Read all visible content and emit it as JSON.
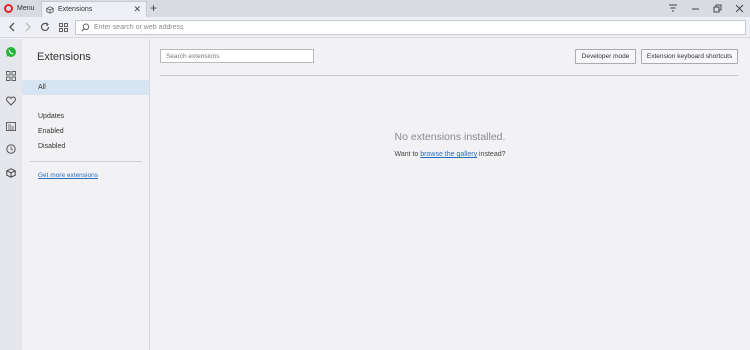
{
  "tabbar": {
    "menu_label": "Menu",
    "tab_title": "Extensions",
    "tab_icon": "cube-icon",
    "close_glyph": "✕",
    "new_tab_glyph": "+"
  },
  "addressbar": {
    "placeholder": "Enter search or web address"
  },
  "sidebar_icons": [
    "whatsapp-icon",
    "speed-dial-icon",
    "heart-icon",
    "news-icon",
    "history-icon",
    "extensions-icon"
  ],
  "extnav": {
    "title": "Extensions",
    "items": [
      {
        "label": "All",
        "active": true
      },
      {
        "label": "Updates"
      },
      {
        "label": "Enabled"
      },
      {
        "label": "Disabled"
      }
    ],
    "more_link": "Get more extensions"
  },
  "main": {
    "search_placeholder": "Search extensions",
    "developer_mode": "Developer mode",
    "keyboard_shortcuts": "Extension keyboard shortcuts",
    "empty_title": "No extensions installed.",
    "empty_prefix": "Want to ",
    "empty_link": "browse the gallery",
    "empty_suffix": " instead?"
  },
  "colors": {
    "opera_red": "#e3232b",
    "whatsapp_green": "#25b53a",
    "link_blue": "#2a6dbf",
    "active_nav": "#d7e4f1"
  }
}
